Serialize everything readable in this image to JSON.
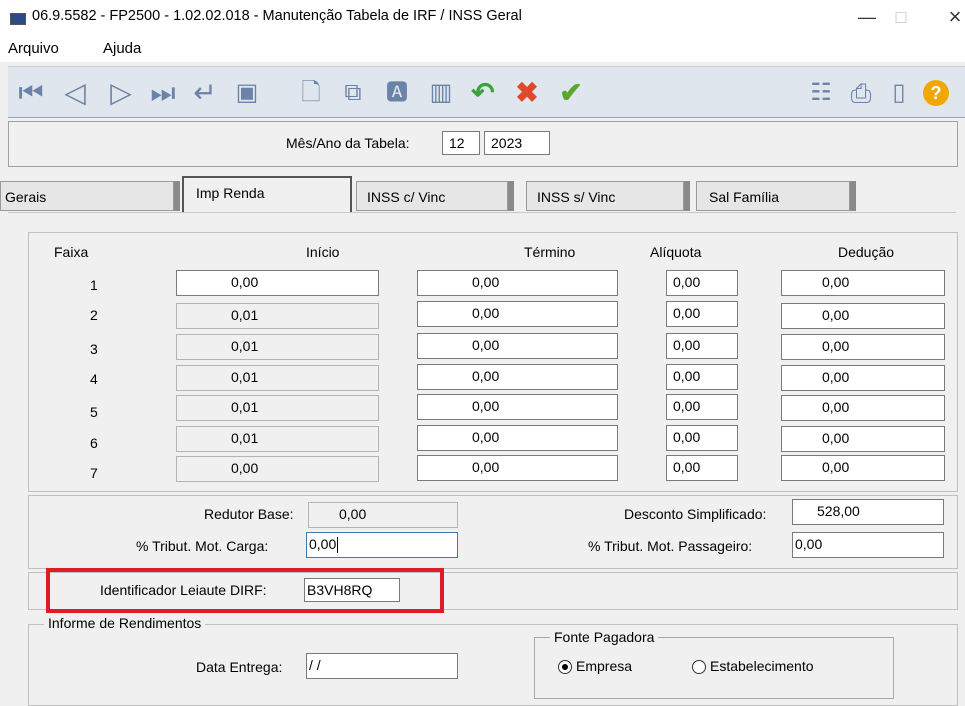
{
  "window": {
    "title": "06.9.5582 - FP2500 - 1.02.02.018 - Manutenção Tabela de IRF / INSS Geral",
    "minimize": "—",
    "maximize": "□",
    "close": "×"
  },
  "menu": [
    "Arquivo",
    "Ajuda"
  ],
  "toolbar": {
    "icons": [
      "first-record-icon",
      "previous-record-icon",
      "next-record-icon",
      "last-record-icon",
      "return-icon",
      "zoom-icon",
      "new-document-icon",
      "copy-icon",
      "edit-icon",
      "delete-icon",
      "undo-icon",
      "cancel-icon",
      "confirm-icon",
      "tree-icon",
      "print-icon",
      "exit-icon",
      "help-icon"
    ],
    "colors": {
      "accent": "#6a83a7",
      "undo": "#3aa33a",
      "cancel": "#e0482a",
      "confirm": "#5aa832",
      "help": "#f0a800"
    }
  },
  "header": {
    "mes_ano_label": "Mês/Ano da Tabela:",
    "mes": "12",
    "ano": "2023"
  },
  "tabs": [
    "Gerais",
    "Imp Renda",
    "INSS c/ Vinc",
    "INSS s/ Vinc",
    "Sal Família"
  ],
  "active_tab": "Imp Renda",
  "table": {
    "headers": {
      "faixa": "Faixa",
      "inicio": "Início",
      "termino": "Término",
      "aliquota": "Alíquota",
      "deducao": "Dedução"
    },
    "rows": [
      {
        "faixa": "1",
        "inicio": "0,00",
        "termino": "0,00",
        "aliquota": "0,00",
        "deducao": "0,00"
      },
      {
        "faixa": "2",
        "inicio": "0,01",
        "termino": "0,00",
        "aliquota": "0,00",
        "deducao": "0,00"
      },
      {
        "faixa": "3",
        "inicio": "0,01",
        "termino": "0,00",
        "aliquota": "0,00",
        "deducao": "0,00"
      },
      {
        "faixa": "4",
        "inicio": "0,01",
        "termino": "0,00",
        "aliquota": "0,00",
        "deducao": "0,00"
      },
      {
        "faixa": "5",
        "inicio": "0,01",
        "termino": "0,00",
        "aliquota": "0,00",
        "deducao": "0,00"
      },
      {
        "faixa": "6",
        "inicio": "0,01",
        "termino": "0,00",
        "aliquota": "0,00",
        "deducao": "0,00"
      },
      {
        "faixa": "7",
        "inicio": "0,00",
        "termino": "0,00",
        "aliquota": "0,00",
        "deducao": "0,00"
      }
    ]
  },
  "extra": {
    "redutor_base_label": "Redutor Base:",
    "redutor_base": "0,00",
    "desconto_simplificado_label": "Desconto Simplificado:",
    "desconto_simplificado": "528,00",
    "tribut_carga_label": "% Tribut. Mot. Carga:",
    "tribut_carga": "0,00",
    "tribut_passageiro_label": "% Tribut. Mot. Passageiro:",
    "tribut_passageiro": "0,00"
  },
  "dirf": {
    "label": "Identificador Leiaute DIRF:",
    "value": "B3VH8RQ",
    "highlight_color": "#e01b24"
  },
  "informe": {
    "title": "Informe de Rendimentos",
    "data_entrega_label": "Data Entrega:",
    "data_entrega": " / /",
    "fonte_title": "Fonte Pagadora",
    "options": [
      "Empresa",
      "Estabelecimento"
    ],
    "selected": "Empresa"
  }
}
